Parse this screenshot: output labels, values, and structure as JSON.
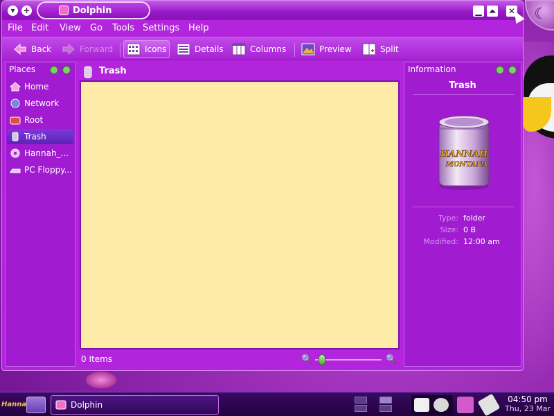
{
  "window": {
    "title": "Dolphin"
  },
  "menubar": {
    "items": [
      "File",
      "Edit",
      "View",
      "Go",
      "Tools",
      "Settings",
      "Help"
    ]
  },
  "toolbar": {
    "back": "Back",
    "forward": "Forward",
    "icons": "Icons",
    "details": "Details",
    "columns": "Columns",
    "preview": "Preview",
    "split": "Split"
  },
  "places": {
    "title": "Places",
    "items": [
      {
        "label": "Home",
        "icon": "home-icon"
      },
      {
        "label": "Network",
        "icon": "network-icon"
      },
      {
        "label": "Root",
        "icon": "root-folder-icon"
      },
      {
        "label": "Trash",
        "icon": "trash-icon"
      },
      {
        "label": "Hannah_...",
        "icon": "cdrom-icon"
      },
      {
        "label": "PC Floppy...",
        "icon": "floppy-icon"
      }
    ],
    "selected": "Trash"
  },
  "main": {
    "location": "Trash",
    "status": "0 Items",
    "zoom_level_fraction": 0.1
  },
  "info": {
    "title": "Information",
    "name": "Trash",
    "preview_brand_line1": "HANNAH",
    "preview_brand_line2": "MONTANA",
    "meta": [
      {
        "key": "Type:",
        "value": "folder"
      },
      {
        "key": "Size:",
        "value": "0 B"
      },
      {
        "key": "Modified:",
        "value": "12:00 am"
      }
    ]
  },
  "taskbar": {
    "launcher_text": "Hannah",
    "task_label": "Dolphin",
    "clock_time": "04:50 pm",
    "clock_date": "Thu, 23 Mar"
  },
  "colors": {
    "window_bg": "#b325dc",
    "view_bg": "#ffeba8",
    "taskbar_bg": "#2a0449",
    "selection": "#6a2cc8"
  }
}
